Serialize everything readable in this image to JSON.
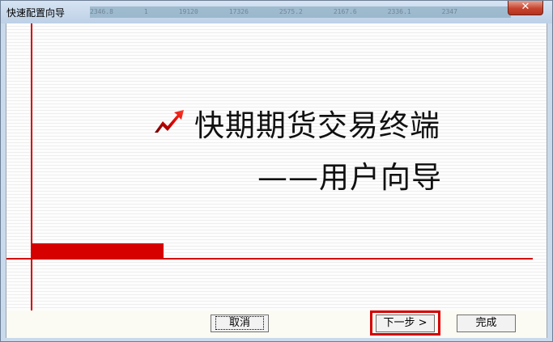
{
  "window": {
    "title": "快速配置向导",
    "close_symbol": "✕",
    "background_strip": [
      "2346.8",
      "1",
      "19120",
      "17326",
      "2575.2",
      "2167.6",
      "2336.1",
      "2347"
    ]
  },
  "content": {
    "title": "快期期货交易终端",
    "subtitle": "——用户向导",
    "logo_icon": "red-arrow-logo-icon"
  },
  "buttons": {
    "cancel": "取消",
    "next": "下一步 >",
    "finish": "完成"
  },
  "colors": {
    "accent_red": "#d60000",
    "highlight_red": "#d40000",
    "titlebar": "#c9daec",
    "close_button": "#c6452f"
  }
}
